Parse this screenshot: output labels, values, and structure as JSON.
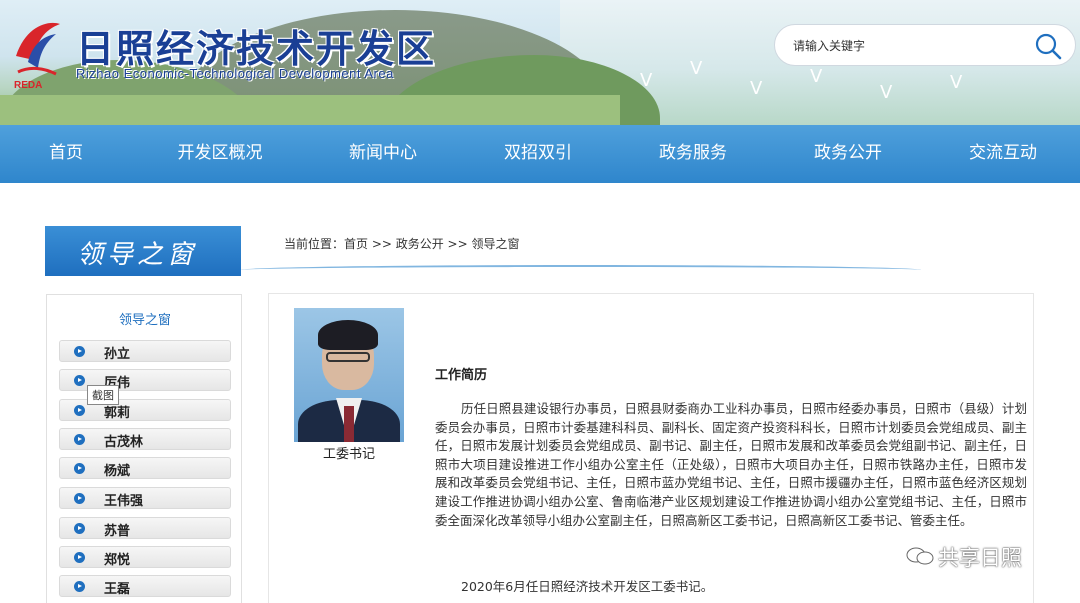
{
  "header": {
    "site_title": "日照经济技术开发区",
    "site_subtitle": "Rizhao Economic-Technological Development Area",
    "logo_text": "REDA",
    "search_placeholder": "请输入关键字"
  },
  "nav": [
    "首页",
    "开发区概况",
    "新闻中心",
    "双招双引",
    "政务服务",
    "政务公开",
    "交流互动"
  ],
  "section": {
    "heading": "领导之窗",
    "breadcrumb": "当前位置：首页 >> 政务公开 >> 领导之窗"
  },
  "sidebar": {
    "title": "领导之窗",
    "items": [
      "孙立",
      "厉伟",
      "郭莉",
      "古茂林",
      "杨斌",
      "王伟强",
      "苏普",
      "郑悦",
      "王磊"
    ]
  },
  "tooltip": "截图",
  "profile": {
    "position": "工委书记",
    "bio_heading": "工作简历",
    "bio": "历任日照县建设银行办事员，日照县财委商办工业科办事员，日照市经委办事员，日照市（县级）计划委员会办事员，日照市计委基建科科员、副科长、固定资产投资科科长，日照市计划委员会党组成员、副主任，日照市发展计划委员会党组成员、副书记、副主任，日照市发展和改革委员会党组副书记、副主任，日照市大项目建设推进工作小组办公室主任（正处级），日照市大项目办主任，日照市铁路办主任，日照市发展和改革委员会党组书记、主任，日照市蓝办党组书记、主任，日照市援疆办主任，日照市蓝色经济区规划建设工作推进协调小组办公室、鲁南临港产业区规划建设工作推进协调小组办公室党组书记、主任，日照市委全面深化改革领导小组办公室副主任，日照高新区工委书记，日照高新区工委书记、管委主任。",
    "note": "2020年6月任日照经济技术开发区工委书记。"
  },
  "watermark": "共享日照",
  "colors": {
    "nav": "#2f86cc",
    "title": "#1a3f95",
    "accent": "#1f6fbf"
  }
}
